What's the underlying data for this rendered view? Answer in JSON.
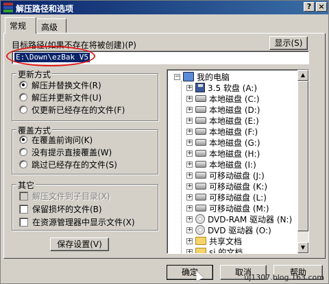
{
  "window": {
    "title": "解压路径和选项",
    "help_btn": "?",
    "close_btn": "×"
  },
  "tabs": [
    {
      "label": "常规"
    },
    {
      "label": "高级"
    }
  ],
  "target": {
    "label": "目标路径(如果不存在将被创建)(P)",
    "value": "E:\\Down\\ezBak V5",
    "show_button": "显示(S)"
  },
  "update_mode": {
    "title": "更新方式",
    "options": [
      {
        "label": "解压并替换文件(R)",
        "selected": true
      },
      {
        "label": "解压并更新文件(U)",
        "selected": false
      },
      {
        "label": "仅更新已经存在的文件(F)",
        "selected": false
      }
    ]
  },
  "overwrite_mode": {
    "title": "覆盖方式",
    "options": [
      {
        "label": "在覆盖前询问(K)",
        "selected": true
      },
      {
        "label": "没有提示直接覆盖(W)",
        "selected": false
      },
      {
        "label": "跳过已经存在的文件(S)",
        "selected": false
      }
    ]
  },
  "misc": {
    "title": "其它",
    "options": [
      {
        "label": "解压文件到子目录(X)",
        "checked": false,
        "disabled": true
      },
      {
        "label": "保留损坏的文件(B)",
        "checked": false,
        "disabled": false
      },
      {
        "label": "在资源管理器中显示文件(X)",
        "checked": false,
        "disabled": false
      }
    ]
  },
  "save_button": "保存设置(V)",
  "tree": {
    "root": "我的电脑",
    "items": [
      {
        "label": "3.5 软盘 (A:)",
        "icon": "floppy-icon"
      },
      {
        "label": "本地磁盘 (C:)",
        "icon": "drive-icon"
      },
      {
        "label": "本地磁盘 (D:)",
        "icon": "drive-icon"
      },
      {
        "label": "本地磁盘 (E:)",
        "icon": "drive-icon"
      },
      {
        "label": "本地磁盘 (F:)",
        "icon": "drive-icon"
      },
      {
        "label": "本地磁盘 (G:)",
        "icon": "drive-icon"
      },
      {
        "label": "本地磁盘 (H:)",
        "icon": "drive-icon"
      },
      {
        "label": "本地磁盘 (I:)",
        "icon": "drive-icon"
      },
      {
        "label": "可移动磁盘 (J:)",
        "icon": "drive-icon"
      },
      {
        "label": "可移动磁盘 (K:)",
        "icon": "drive-icon"
      },
      {
        "label": "可移动磁盘 (L:)",
        "icon": "drive-icon"
      },
      {
        "label": "可移动磁盘 (M:)",
        "icon": "drive-icon"
      },
      {
        "label": "DVD-RAM 驱动器 (N:)",
        "icon": "cd-icon"
      },
      {
        "label": "DVD 驱动器 (O:)",
        "icon": "cd-icon"
      },
      {
        "label": "共享文档",
        "icon": "folder-icon"
      },
      {
        "label": "sj 的文档",
        "icon": "folder-icon"
      }
    ]
  },
  "buttons": {
    "ok": "确定",
    "cancel": "取消",
    "help": "帮助"
  },
  "watermark": "uj1307.blog.163.com"
}
